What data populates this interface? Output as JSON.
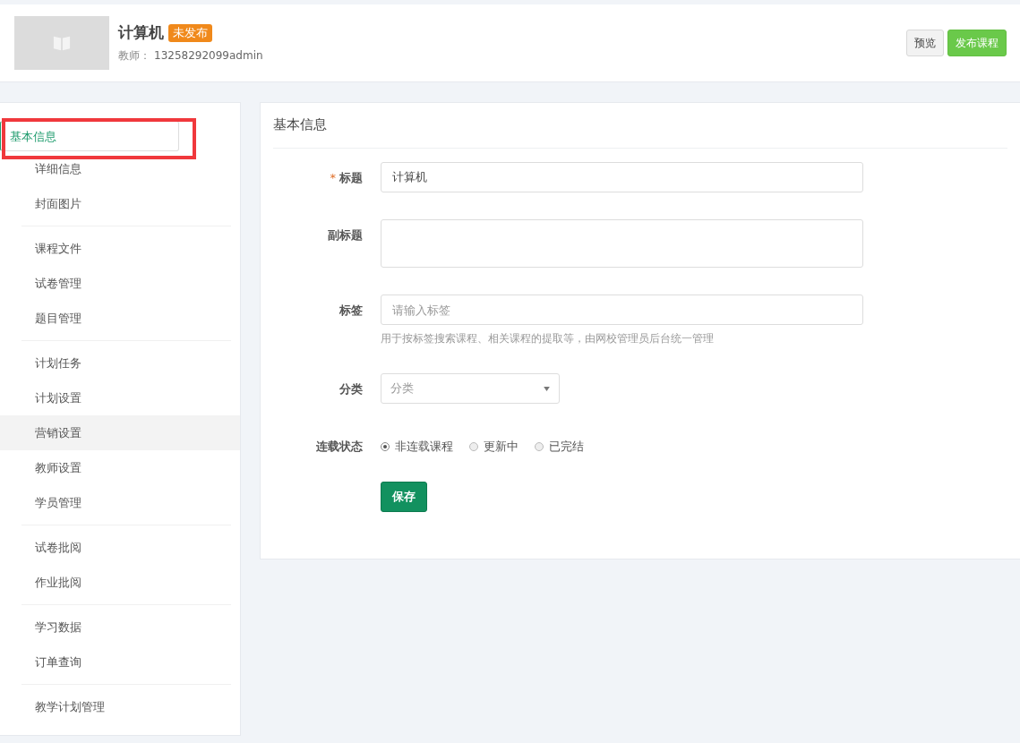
{
  "header": {
    "course_title": "计算机",
    "status_badge": "未发布",
    "teacher_label": "教师：",
    "teacher_name": "13258292099admin",
    "buttons": [
      {
        "label": "预览",
        "kind": "default"
      },
      {
        "label": "发布课程",
        "kind": "primary"
      }
    ]
  },
  "sidebar": {
    "groups": [
      {
        "items": [
          {
            "label": "基本信息",
            "selected": true,
            "hovered": false,
            "annotated": true
          },
          {
            "label": "详细信息",
            "selected": false,
            "hovered": false,
            "annotated": false
          },
          {
            "label": "封面图片",
            "selected": false,
            "hovered": false,
            "annotated": false
          }
        ]
      },
      {
        "items": [
          {
            "label": "课程文件",
            "selected": false,
            "hovered": false,
            "annotated": false
          },
          {
            "label": "试卷管理",
            "selected": false,
            "hovered": false,
            "annotated": false
          },
          {
            "label": "题目管理",
            "selected": false,
            "hovered": false,
            "annotated": false
          }
        ]
      },
      {
        "items": [
          {
            "label": "计划任务",
            "selected": false,
            "hovered": false,
            "annotated": false
          },
          {
            "label": "计划设置",
            "selected": false,
            "hovered": false,
            "annotated": false
          },
          {
            "label": "营销设置",
            "selected": false,
            "hovered": true,
            "annotated": false
          },
          {
            "label": "教师设置",
            "selected": false,
            "hovered": false,
            "annotated": false
          },
          {
            "label": "学员管理",
            "selected": false,
            "hovered": false,
            "annotated": false
          }
        ]
      },
      {
        "items": [
          {
            "label": "试卷批阅",
            "selected": false,
            "hovered": false,
            "annotated": false
          },
          {
            "label": "作业批阅",
            "selected": false,
            "hovered": false,
            "annotated": false
          }
        ]
      },
      {
        "items": [
          {
            "label": "学习数据",
            "selected": false,
            "hovered": false,
            "annotated": false
          },
          {
            "label": "订单查询",
            "selected": false,
            "hovered": false,
            "annotated": false
          }
        ]
      },
      {
        "items": [
          {
            "label": "教学计划管理",
            "selected": false,
            "hovered": false,
            "annotated": false
          }
        ]
      }
    ]
  },
  "panel": {
    "title": "基本信息",
    "fields": [
      {
        "kind": "input",
        "label": "标题",
        "required_mark": "*",
        "value": "计算机"
      },
      {
        "kind": "textarea",
        "label": "副标题"
      },
      {
        "kind": "input",
        "label": "标签",
        "placeholder": "请输入标签",
        "help": "用于按标签搜索课程、相关课程的提取等，由网校管理员后台统一管理"
      },
      {
        "kind": "select",
        "label": "分类",
        "placeholder": "分类"
      },
      {
        "kind": "radio",
        "label": "连载状态",
        "options": [
          {
            "label": "非连载课程",
            "selected": true
          },
          {
            "label": "更新中",
            "selected": false
          },
          {
            "label": "已完结",
            "selected": false
          }
        ]
      }
    ],
    "save_button": "保存"
  }
}
